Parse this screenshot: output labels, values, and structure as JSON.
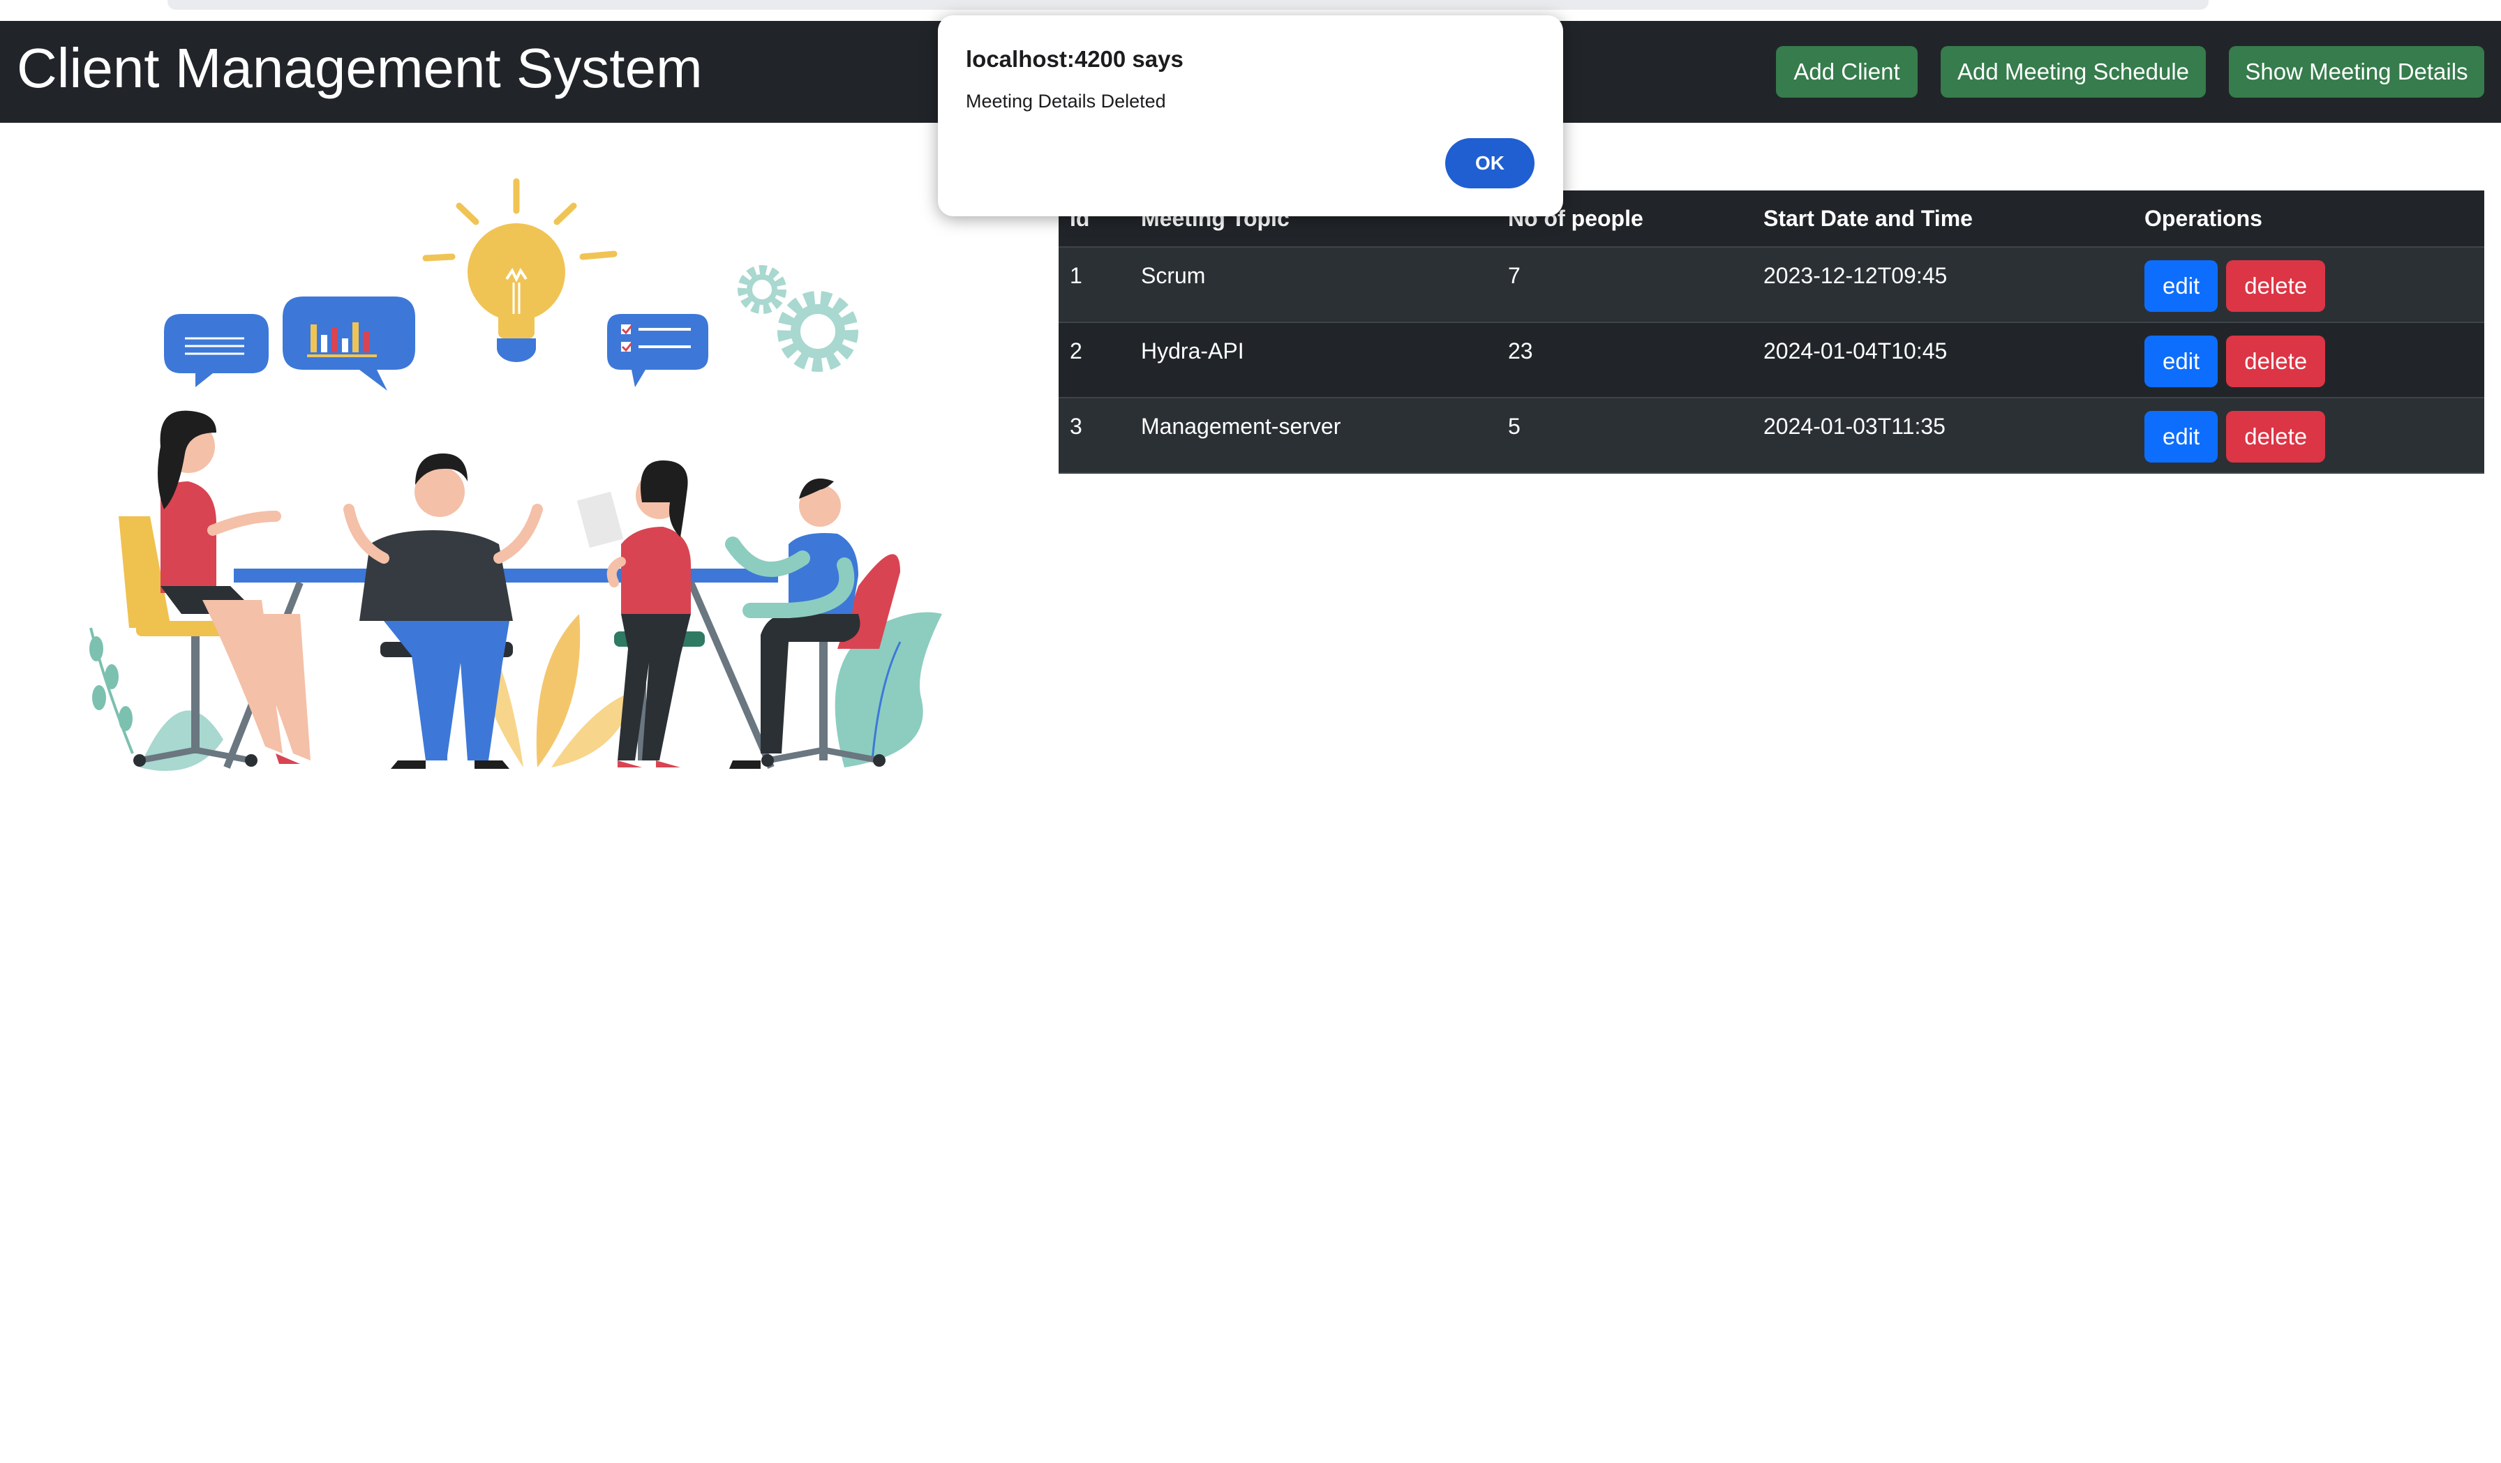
{
  "navbar": {
    "brand": "Client Management System",
    "buttons": {
      "add_client": "Add Client",
      "add_meeting": "Add Meeting Schedule",
      "show_meeting": "Show Meeting Details"
    }
  },
  "table": {
    "headers": [
      "Id",
      "Meeting Topic",
      "No of people",
      "Start Date and Time",
      "Operations"
    ],
    "rows": [
      {
        "id": "1",
        "topic": "Scrum",
        "people": "7",
        "start": "2023-12-12T09:45"
      },
      {
        "id": "2",
        "topic": "Hydra-API",
        "people": "23",
        "start": "2024-01-04T10:45"
      },
      {
        "id": "3",
        "topic": "Management-server",
        "people": "5",
        "start": "2024-01-03T11:35"
      }
    ],
    "edit_label": "edit",
    "delete_label": "delete"
  },
  "dialog": {
    "title": "localhost:4200 says",
    "message": "Meeting Details Deleted",
    "ok_label": "OK"
  },
  "colors": {
    "navbar": "#212529",
    "nav_button": "#367c4c",
    "edit": "#0d6efd",
    "delete": "#dc3545",
    "ok": "#1f5fd1"
  }
}
